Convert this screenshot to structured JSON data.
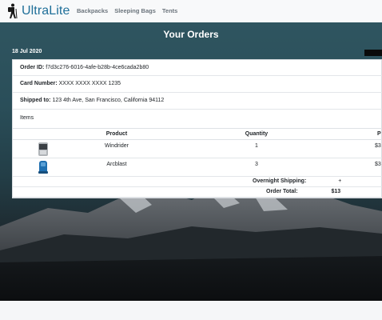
{
  "brand": {
    "name": "UltraLite",
    "logo_icon": "hiker-icon"
  },
  "nav": {
    "links": [
      "Backpacks",
      "Sleeping Bags",
      "Tents"
    ]
  },
  "page": {
    "title": "Your Orders"
  },
  "order": {
    "date": "18 Jul 2020",
    "id_label": "Order ID:",
    "id_value": "f7d3c276-6016-4afe-b28b-4ce6cada2b80",
    "card_label": "Card Number:",
    "card_value": "XXXX XXXX XXXX 1235",
    "ship_label": "Shipped to:",
    "ship_value": "123 4th Ave, San Francisco, California 94112",
    "items_label": "Items"
  },
  "table": {
    "headers": [
      "Product",
      "Quantity",
      "P"
    ],
    "rows": [
      {
        "product": "Windrider",
        "quantity": "1",
        "price": "$3",
        "thumb_icon": "backpack-icon"
      },
      {
        "product": "Arcblast",
        "quantity": "3",
        "price": "$3",
        "thumb_icon": "sleeping-bag-icon"
      }
    ],
    "shipping_label": "Overnight Shipping:",
    "shipping_value": "+",
    "total_label": "Order Total:",
    "total_value": "$13"
  }
}
